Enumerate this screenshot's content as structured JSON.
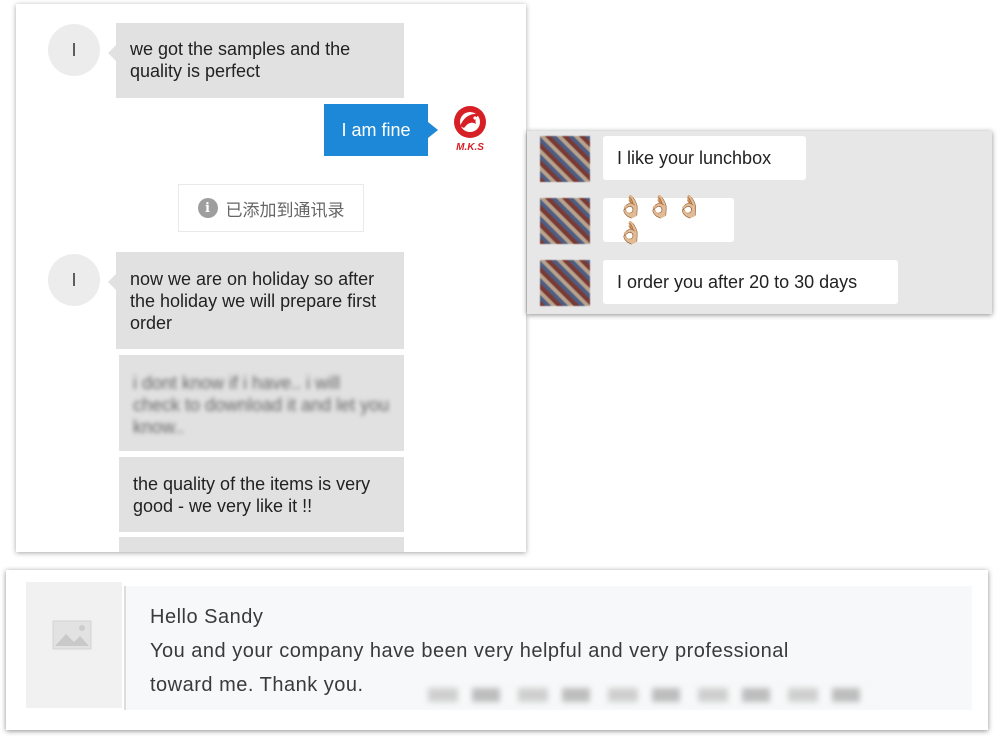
{
  "left_chat": {
    "messages": [
      {
        "avatar": "I",
        "text": "we got the samples and the quality is perfect"
      },
      {
        "text": "I am fine"
      },
      {
        "notice": "已添加到通讯录"
      },
      {
        "avatar": "I",
        "text": "now we are on holiday so after the holiday we will prepare first order"
      },
      {
        "text": "i dont know if i have.. i will check to download it and let you know.."
      },
      {
        "text": "the quality of the items is very good - we very like it !!"
      }
    ],
    "logo_text": "M.K.S",
    "accent": "#1e88d8"
  },
  "right_chat": {
    "messages": [
      {
        "text": "I like your lunchbox"
      },
      {
        "text": "👌🏼👌🏼👌🏼👌🏼"
      },
      {
        "text": "I order you after 20 to 30 days"
      }
    ]
  },
  "email": {
    "greeting": "Hello Sandy",
    "line1": "You and your company have been very helpful and very professional",
    "line2": "toward me.  Thank you."
  }
}
